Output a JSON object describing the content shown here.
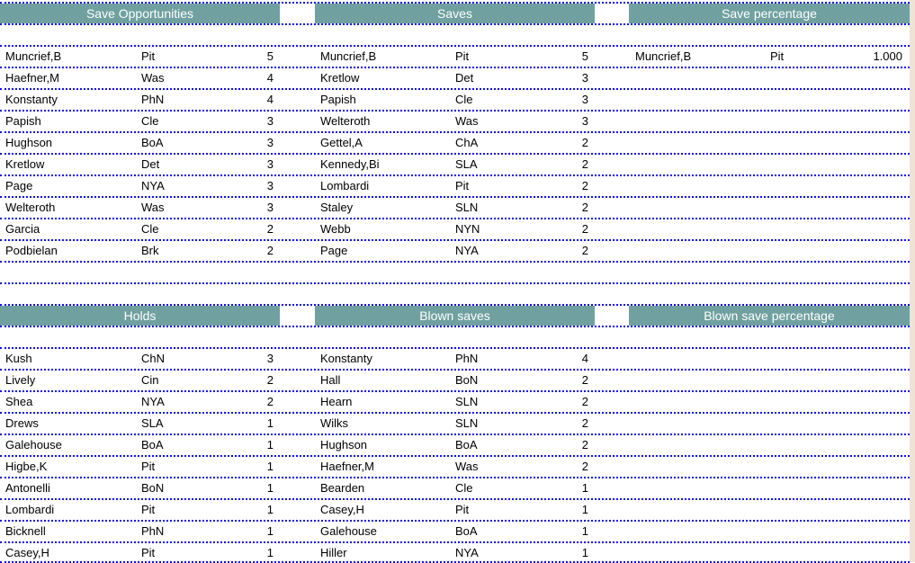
{
  "sections": [
    {
      "blocks": [
        {
          "title": "Save Opportunities",
          "rows": [
            {
              "name": "Muncrief,B",
              "team": "Pit",
              "value": "5"
            },
            {
              "name": "Haefner,M",
              "team": "Was",
              "value": "4"
            },
            {
              "name": "Konstanty",
              "team": "PhN",
              "value": "4"
            },
            {
              "name": "Papish",
              "team": "Cle",
              "value": "3"
            },
            {
              "name": "Hughson",
              "team": "BoA",
              "value": "3"
            },
            {
              "name": "Kretlow",
              "team": "Det",
              "value": "3"
            },
            {
              "name": "Page",
              "team": "NYA",
              "value": "3"
            },
            {
              "name": "Welteroth",
              "team": "Was",
              "value": "3"
            },
            {
              "name": "Garcia",
              "team": "Cle",
              "value": "2"
            },
            {
              "name": "Podbielan",
              "team": "Brk",
              "value": "2"
            }
          ]
        },
        {
          "title": "Saves",
          "rows": [
            {
              "name": "Muncrief,B",
              "team": "Pit",
              "value": "5"
            },
            {
              "name": "Kretlow",
              "team": "Det",
              "value": "3"
            },
            {
              "name": "Papish",
              "team": "Cle",
              "value": "3"
            },
            {
              "name": "Welteroth",
              "team": "Was",
              "value": "3"
            },
            {
              "name": "Gettel,A",
              "team": "ChA",
              "value": "2"
            },
            {
              "name": "Kennedy,Bi",
              "team": "SLA",
              "value": "2"
            },
            {
              "name": "Lombardi",
              "team": "Pit",
              "value": "2"
            },
            {
              "name": "Staley",
              "team": "SLN",
              "value": "2"
            },
            {
              "name": "Webb",
              "team": "NYN",
              "value": "2"
            },
            {
              "name": "Page",
              "team": "NYA",
              "value": "2"
            }
          ]
        },
        {
          "title": "Save percentage",
          "rows": [
            {
              "name": "Muncrief,B",
              "team": "Pit",
              "value": "1.000"
            }
          ]
        }
      ]
    },
    {
      "blocks": [
        {
          "title": "Holds",
          "rows": [
            {
              "name": "Kush",
              "team": "ChN",
              "value": "3"
            },
            {
              "name": "Lively",
              "team": "Cin",
              "value": "2"
            },
            {
              "name": "Shea",
              "team": "NYA",
              "value": "2"
            },
            {
              "name": "Drews",
              "team": "SLA",
              "value": "1"
            },
            {
              "name": "Galehouse",
              "team": "BoA",
              "value": "1"
            },
            {
              "name": "Higbe,K",
              "team": "Pit",
              "value": "1"
            },
            {
              "name": "Antonelli",
              "team": "BoN",
              "value": "1"
            },
            {
              "name": "Lombardi",
              "team": "Pit",
              "value": "1"
            },
            {
              "name": "Bicknell",
              "team": "PhN",
              "value": "1"
            },
            {
              "name": "Casey,H",
              "team": "Pit",
              "value": "1"
            }
          ]
        },
        {
          "title": "Blown saves",
          "rows": [
            {
              "name": "Konstanty",
              "team": "PhN",
              "value": "4"
            },
            {
              "name": "Hall",
              "team": "BoN",
              "value": "2"
            },
            {
              "name": "Hearn",
              "team": "SLN",
              "value": "2"
            },
            {
              "name": "Wilks",
              "team": "SLN",
              "value": "2"
            },
            {
              "name": "Hughson",
              "team": "BoA",
              "value": "2"
            },
            {
              "name": "Haefner,M",
              "team": "Was",
              "value": "2"
            },
            {
              "name": "Bearden",
              "team": "Cle",
              "value": "1"
            },
            {
              "name": "Casey,H",
              "team": "Pit",
              "value": "1"
            },
            {
              "name": "Galehouse",
              "team": "BoA",
              "value": "1"
            },
            {
              "name": "Hiller",
              "team": "NYA",
              "value": "1"
            }
          ]
        },
        {
          "title": "Blown save percentage",
          "rows": []
        }
      ]
    }
  ]
}
